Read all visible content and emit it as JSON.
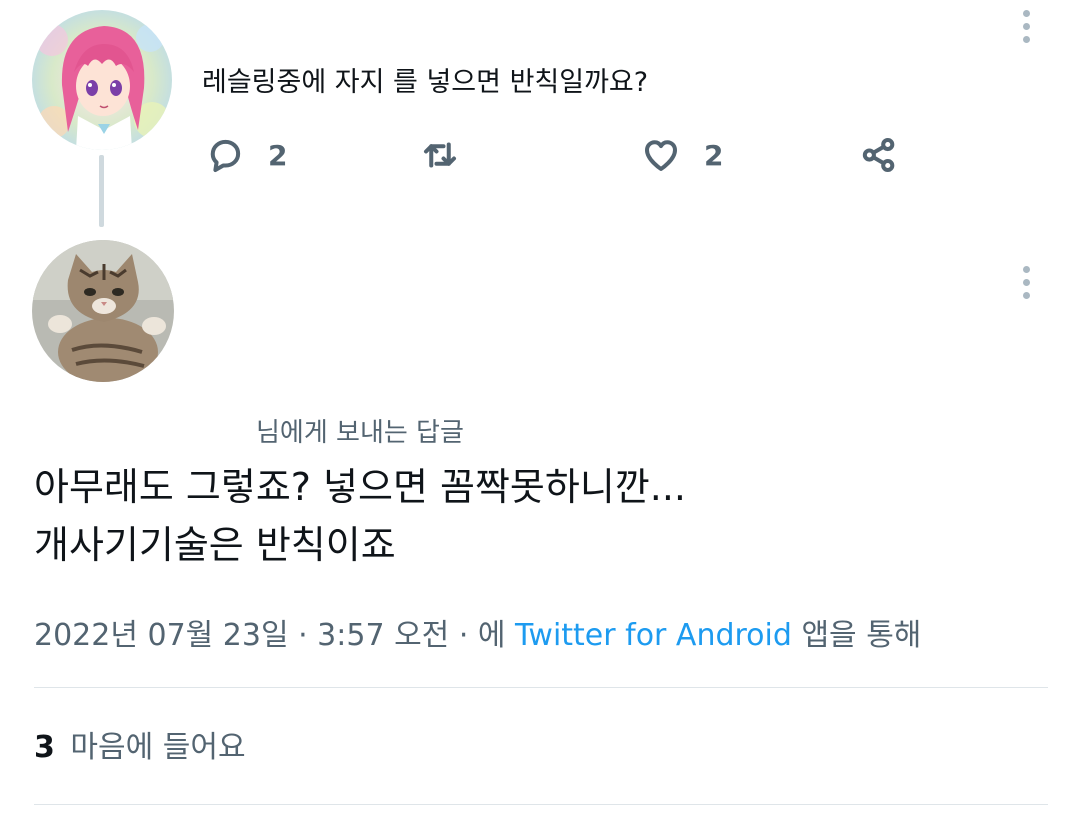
{
  "parent_tweet": {
    "text": "레슬링중에 자지 를 넣으면 반칙일까요?",
    "avatar_icon": "anime-girl-avatar",
    "actions": {
      "reply_count": "2",
      "retweet_count": "",
      "like_count": "2"
    }
  },
  "reply_tweet": {
    "avatar_icon": "kitten-avatar",
    "replying_to": "님에게 보내는 답글",
    "lines": [
      "아무래도 그렇죠? 넣으면 꼼짝못하니깐...",
      "개사기기술은 반칙이죠"
    ],
    "timestamp": "2022년 07월 23일 · 3:57 오전 · 에",
    "source": "Twitter for Android",
    "source_suffix": "앱을 통해",
    "likes_count": "3",
    "likes_label": "마음에 들어요"
  },
  "colors": {
    "accent": "#1d9bf0",
    "secondary_text": "#536471",
    "primary_text": "#0f1419",
    "divider": "#dfe5e9",
    "thread_line": "#cfd9de"
  }
}
